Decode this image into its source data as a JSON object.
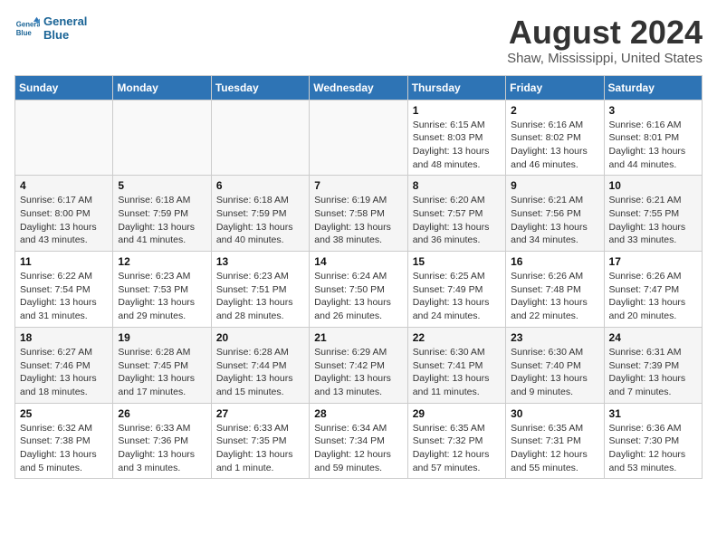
{
  "logo": {
    "line1": "General",
    "line2": "Blue"
  },
  "title": "August 2024",
  "subtitle": "Shaw, Mississippi, United States",
  "days_of_week": [
    "Sunday",
    "Monday",
    "Tuesday",
    "Wednesday",
    "Thursday",
    "Friday",
    "Saturday"
  ],
  "weeks": [
    [
      {
        "day": "",
        "detail": ""
      },
      {
        "day": "",
        "detail": ""
      },
      {
        "day": "",
        "detail": ""
      },
      {
        "day": "",
        "detail": ""
      },
      {
        "day": "1",
        "detail": "Sunrise: 6:15 AM\nSunset: 8:03 PM\nDaylight: 13 hours\nand 48 minutes."
      },
      {
        "day": "2",
        "detail": "Sunrise: 6:16 AM\nSunset: 8:02 PM\nDaylight: 13 hours\nand 46 minutes."
      },
      {
        "day": "3",
        "detail": "Sunrise: 6:16 AM\nSunset: 8:01 PM\nDaylight: 13 hours\nand 44 minutes."
      }
    ],
    [
      {
        "day": "4",
        "detail": "Sunrise: 6:17 AM\nSunset: 8:00 PM\nDaylight: 13 hours\nand 43 minutes."
      },
      {
        "day": "5",
        "detail": "Sunrise: 6:18 AM\nSunset: 7:59 PM\nDaylight: 13 hours\nand 41 minutes."
      },
      {
        "day": "6",
        "detail": "Sunrise: 6:18 AM\nSunset: 7:59 PM\nDaylight: 13 hours\nand 40 minutes."
      },
      {
        "day": "7",
        "detail": "Sunrise: 6:19 AM\nSunset: 7:58 PM\nDaylight: 13 hours\nand 38 minutes."
      },
      {
        "day": "8",
        "detail": "Sunrise: 6:20 AM\nSunset: 7:57 PM\nDaylight: 13 hours\nand 36 minutes."
      },
      {
        "day": "9",
        "detail": "Sunrise: 6:21 AM\nSunset: 7:56 PM\nDaylight: 13 hours\nand 34 minutes."
      },
      {
        "day": "10",
        "detail": "Sunrise: 6:21 AM\nSunset: 7:55 PM\nDaylight: 13 hours\nand 33 minutes."
      }
    ],
    [
      {
        "day": "11",
        "detail": "Sunrise: 6:22 AM\nSunset: 7:54 PM\nDaylight: 13 hours\nand 31 minutes."
      },
      {
        "day": "12",
        "detail": "Sunrise: 6:23 AM\nSunset: 7:53 PM\nDaylight: 13 hours\nand 29 minutes."
      },
      {
        "day": "13",
        "detail": "Sunrise: 6:23 AM\nSunset: 7:51 PM\nDaylight: 13 hours\nand 28 minutes."
      },
      {
        "day": "14",
        "detail": "Sunrise: 6:24 AM\nSunset: 7:50 PM\nDaylight: 13 hours\nand 26 minutes."
      },
      {
        "day": "15",
        "detail": "Sunrise: 6:25 AM\nSunset: 7:49 PM\nDaylight: 13 hours\nand 24 minutes."
      },
      {
        "day": "16",
        "detail": "Sunrise: 6:26 AM\nSunset: 7:48 PM\nDaylight: 13 hours\nand 22 minutes."
      },
      {
        "day": "17",
        "detail": "Sunrise: 6:26 AM\nSunset: 7:47 PM\nDaylight: 13 hours\nand 20 minutes."
      }
    ],
    [
      {
        "day": "18",
        "detail": "Sunrise: 6:27 AM\nSunset: 7:46 PM\nDaylight: 13 hours\nand 18 minutes."
      },
      {
        "day": "19",
        "detail": "Sunrise: 6:28 AM\nSunset: 7:45 PM\nDaylight: 13 hours\nand 17 minutes."
      },
      {
        "day": "20",
        "detail": "Sunrise: 6:28 AM\nSunset: 7:44 PM\nDaylight: 13 hours\nand 15 minutes."
      },
      {
        "day": "21",
        "detail": "Sunrise: 6:29 AM\nSunset: 7:42 PM\nDaylight: 13 hours\nand 13 minutes."
      },
      {
        "day": "22",
        "detail": "Sunrise: 6:30 AM\nSunset: 7:41 PM\nDaylight: 13 hours\nand 11 minutes."
      },
      {
        "day": "23",
        "detail": "Sunrise: 6:30 AM\nSunset: 7:40 PM\nDaylight: 13 hours\nand 9 minutes."
      },
      {
        "day": "24",
        "detail": "Sunrise: 6:31 AM\nSunset: 7:39 PM\nDaylight: 13 hours\nand 7 minutes."
      }
    ],
    [
      {
        "day": "25",
        "detail": "Sunrise: 6:32 AM\nSunset: 7:38 PM\nDaylight: 13 hours\nand 5 minutes."
      },
      {
        "day": "26",
        "detail": "Sunrise: 6:33 AM\nSunset: 7:36 PM\nDaylight: 13 hours\nand 3 minutes."
      },
      {
        "day": "27",
        "detail": "Sunrise: 6:33 AM\nSunset: 7:35 PM\nDaylight: 13 hours\nand 1 minute."
      },
      {
        "day": "28",
        "detail": "Sunrise: 6:34 AM\nSunset: 7:34 PM\nDaylight: 12 hours\nand 59 minutes."
      },
      {
        "day": "29",
        "detail": "Sunrise: 6:35 AM\nSunset: 7:32 PM\nDaylight: 12 hours\nand 57 minutes."
      },
      {
        "day": "30",
        "detail": "Sunrise: 6:35 AM\nSunset: 7:31 PM\nDaylight: 12 hours\nand 55 minutes."
      },
      {
        "day": "31",
        "detail": "Sunrise: 6:36 AM\nSunset: 7:30 PM\nDaylight: 12 hours\nand 53 minutes."
      }
    ]
  ]
}
